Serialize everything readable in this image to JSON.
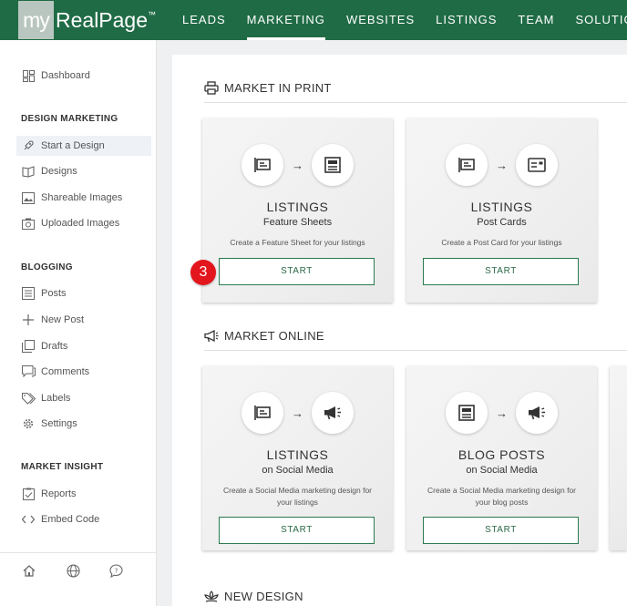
{
  "brand": {
    "prefix": "my",
    "name": "RealPage",
    "mark": "™"
  },
  "nav": [
    {
      "label": "LEADS"
    },
    {
      "label": "MARKETING",
      "active": true
    },
    {
      "label": "WEBSITES"
    },
    {
      "label": "LISTINGS"
    },
    {
      "label": "TEAM"
    },
    {
      "label": "SOLUTIONS"
    }
  ],
  "sidebar": {
    "dashboard": "Dashboard",
    "design_heading": "DESIGN MARKETING",
    "design_items": [
      "Start a Design",
      "Designs",
      "Shareable Images",
      "Uploaded Images"
    ],
    "blogging_heading": "BLOGGING",
    "blogging_items": [
      "Posts",
      "New Post",
      "Drafts",
      "Comments",
      "Labels",
      "Settings"
    ],
    "insight_heading": "MARKET INSIGHT",
    "insight_items": [
      "Reports",
      "Embed Code"
    ],
    "bottom_icons": [
      "home-icon",
      "globe-icon",
      "chat-help-icon"
    ]
  },
  "sections": {
    "print": {
      "title": "MARKET IN PRINT",
      "icon": "printer-icon"
    },
    "online": {
      "title": "MARKET ONLINE",
      "icon": "megaphone-icon"
    },
    "new_design": {
      "title": "NEW DESIGN",
      "icon": "lotus-icon"
    }
  },
  "cards": {
    "feature_sheets": {
      "title": "LISTINGS",
      "subtitle": "Feature Sheets",
      "desc": "Create a Feature Sheet for your listings",
      "button": "START"
    },
    "post_cards": {
      "title": "LISTINGS",
      "subtitle": "Post Cards",
      "desc": "Create a Post Card for your listings",
      "button": "START"
    },
    "listings_social": {
      "title": "LISTINGS",
      "subtitle": "on Social Media",
      "desc": "Create a Social Media marketing design for your listings",
      "button": "START"
    },
    "blog_social": {
      "title": "BLOG POSTS",
      "subtitle": "on Social Media",
      "desc": "Create a Social Media marketing design for your blog posts",
      "button": "START"
    }
  },
  "step_badge": "3",
  "colors": {
    "header": "#1f6b45",
    "accent": "#2b7a4f",
    "badge": "#e4161d"
  }
}
